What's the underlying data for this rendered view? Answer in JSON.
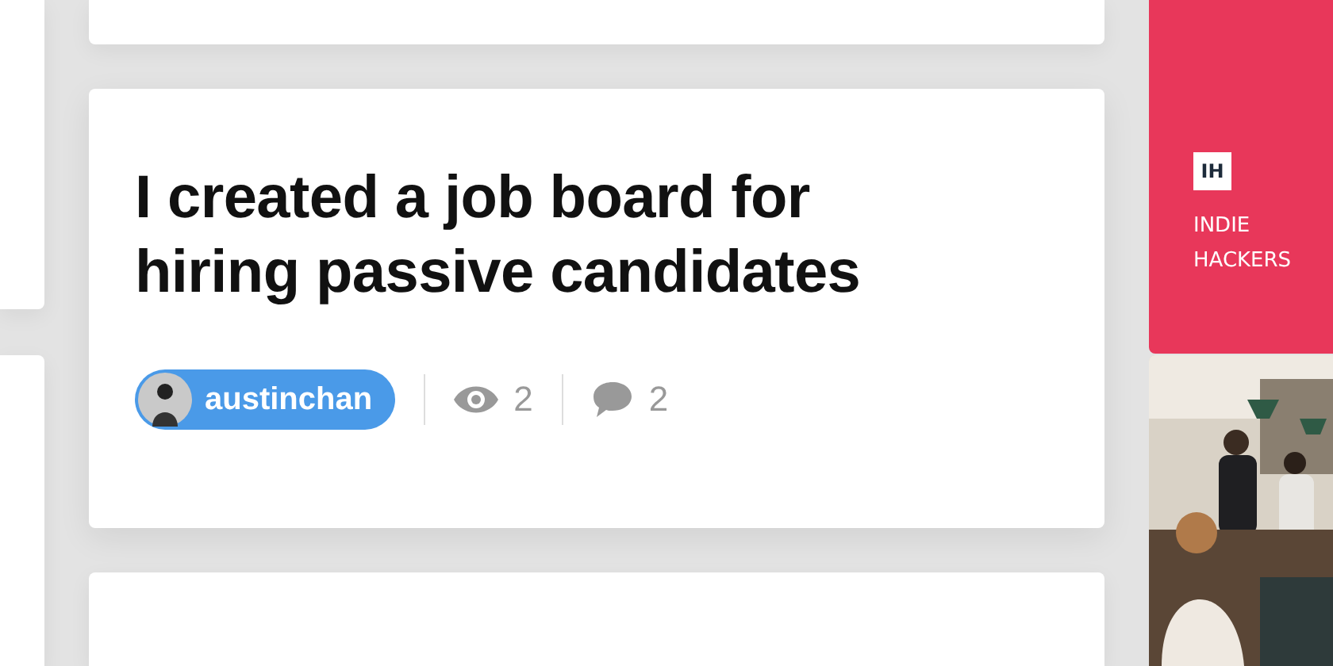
{
  "post": {
    "title": "I created a job board for hiring passive candidates",
    "author": "austinchan",
    "views": "2",
    "comments": "2"
  },
  "brand": {
    "logo": "IH",
    "name": "INDIE HACKERS"
  }
}
